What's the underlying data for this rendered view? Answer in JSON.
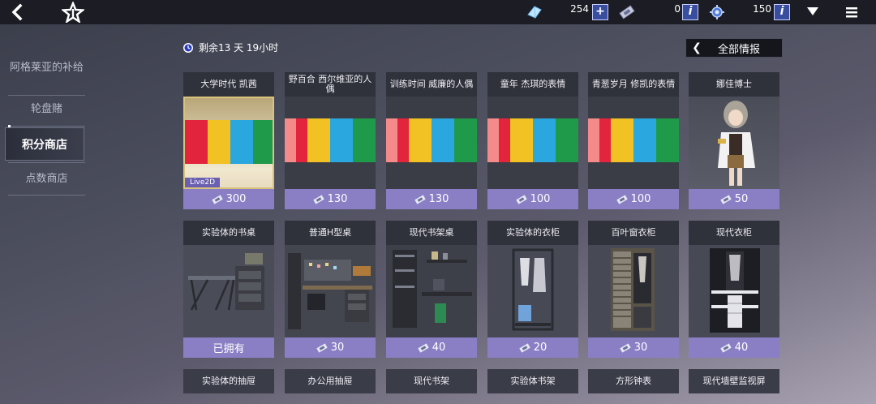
{
  "topbar": {
    "currency1_value": "254",
    "currency2_value": "0",
    "currency3_value": "150",
    "plus_label": "+",
    "info_label": "i"
  },
  "sidebar": {
    "items": [
      {
        "label": "阿格莱亚的补给"
      },
      {
        "label": "轮盘赌"
      },
      {
        "label": "积分商店"
      },
      {
        "label": "点数商店"
      }
    ]
  },
  "timer": {
    "label": "剩余13 天 19小时"
  },
  "all_info_button": {
    "label": "全部情报"
  },
  "live2d_badge": "Live2D",
  "colors": {
    "price_bar": "#8a7fc4",
    "bar_colors": [
      "#e2243c",
      "#f2c124",
      "#2aa7df",
      "#1f9a4a"
    ]
  },
  "cards_row1": [
    {
      "title": "大学时代 凯茜",
      "price": "300"
    },
    {
      "title": "野百合 西尔维亚的人偶",
      "price": "130"
    },
    {
      "title": "训练时间 威廉的人偶",
      "price": "130"
    },
    {
      "title": "童年 杰琪的表情",
      "price": "100"
    },
    {
      "title": "青葱岁月 修凯的表情",
      "price": "100"
    },
    {
      "title": "娜佳博士",
      "price": "50"
    }
  ],
  "cards_row2": [
    {
      "title": "实验体的书桌",
      "price": "已拥有"
    },
    {
      "title": "普通H型桌",
      "price": "30"
    },
    {
      "title": "现代书架桌",
      "price": "40"
    },
    {
      "title": "实验体的衣柜",
      "price": "20"
    },
    {
      "title": "百叶窗衣柜",
      "price": "30"
    },
    {
      "title": "现代衣柜",
      "price": "40"
    }
  ],
  "cards_row3": [
    {
      "title": "实验体的抽屉"
    },
    {
      "title": "办公用抽屉"
    },
    {
      "title": "现代书架"
    },
    {
      "title": "实验体书架"
    },
    {
      "title": "方形钟表"
    },
    {
      "title": "现代墙壁监视屏"
    }
  ]
}
